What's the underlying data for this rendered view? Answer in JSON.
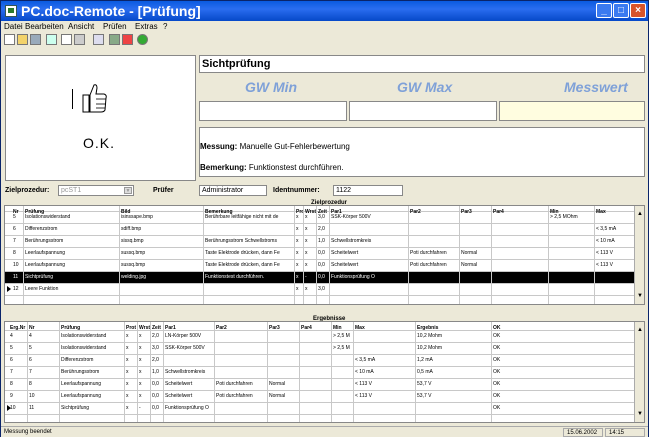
{
  "window": {
    "title": "PC.doc-Remote - [Prüfung]"
  },
  "menu": [
    "Datei",
    "Bearbeiten",
    "Ansicht",
    "Prüfen",
    "Extras",
    "?"
  ],
  "result": {
    "ok_label": "O.K.",
    "test_name": "Sichtprüfung"
  },
  "columns": {
    "gw_min": "GW Min",
    "gw_max": "GW Max",
    "messwert": "Messwert"
  },
  "messung": {
    "label": "Messung:",
    "value": "Manuelle Gut-Fehlerbewertung"
  },
  "bemerkung": {
    "label": "Bemerkung:",
    "value": "Funktionstest durchführen."
  },
  "form": {
    "zielprozedur_label": "Zielprozedur:",
    "zielprozedur_value": "pcST1",
    "pruefer_label": "Prüfer",
    "pruefer_value": "Administrator",
    "ident_label": "Identnummer:",
    "ident_value": "1122"
  },
  "upper_grid": {
    "caption": "Zielprozedur",
    "headers": [
      "Nr",
      "Prüfung",
      "Bild",
      "Bemerkung",
      "Prot",
      "WrstC",
      "Zeit",
      "Par1",
      "Par2",
      "Par3",
      "Par4",
      "Min",
      "Max"
    ],
    "rows": [
      [
        "5",
        "Isolationswiderstand",
        "isinssape.bmp",
        "Berührbare leitfähige nicht mit de",
        "x",
        "x",
        "3,0",
        "SSK-Körper 500V",
        "",
        "",
        "",
        "> 2,5 MOhm",
        ""
      ],
      [
        "6",
        "Differenzstrom",
        "sdiff.bmp",
        "",
        "x",
        "x",
        "2,0",
        "",
        "",
        "",
        "",
        "",
        "< 3,5 mA"
      ],
      [
        "7",
        "Berührungsstrom",
        "sissq.bmp",
        "Berührungsstrom Schwellstroms",
        "x",
        "x",
        "1,0",
        "Schwellstromkreis",
        "",
        "",
        "",
        "",
        "< 10 mA"
      ],
      [
        "8",
        "Leerlaufspannung",
        "sussq.bmp",
        "Taste Elektrode drücken, dann Fe",
        "x",
        "x",
        "0,0",
        "Scheitelwert",
        "Poti durchfahren",
        "Normal",
        "",
        "",
        "< 113 V"
      ],
      [
        "10",
        "Leerlaufspannung",
        "sussq.bmp",
        "Taste Elektrode drücken, dann Fe",
        "x",
        "x",
        "0,0",
        "Scheitelwert",
        "Poti durchfahren",
        "Normal",
        "",
        "",
        "< 113 V"
      ],
      [
        "11",
        "Sichtprüfung",
        "welding.jpg",
        "Funktionstest durchführen.",
        "x",
        "-",
        "0,0",
        "Funktionsprüfung O",
        "",
        "",
        "",
        "",
        ""
      ],
      [
        "12",
        "Leere Funktion",
        "",
        "",
        "x",
        "x",
        "3,0",
        "",
        "",
        "",
        "",
        "",
        ""
      ]
    ]
  },
  "lower_grid": {
    "caption": "Ergebnisse",
    "headers": [
      "Erg.Nr",
      "Nr",
      "Prüfung",
      "Prot",
      "WrstC",
      "Zeit",
      "Par1",
      "Par2",
      "Par3",
      "Par4",
      "Min",
      "Max",
      "Ergebnis",
      "OK"
    ],
    "rows": [
      [
        "4",
        "4",
        "Isolationswiderstand",
        "x",
        "x",
        "2,0",
        "LN-Körper 500V",
        "",
        "",
        "",
        "> 2,5 M",
        "",
        "10,2 Mohm",
        "OK"
      ],
      [
        "5",
        "5",
        "Isolationswiderstand",
        "x",
        "x",
        "3,0",
        "SSK-Körper 500V",
        "",
        "",
        "",
        "> 2,5 M",
        "",
        "10,2 Mohm",
        "OK"
      ],
      [
        "6",
        "6",
        "Differenzstrom",
        "x",
        "x",
        "2,0",
        "",
        "",
        "",
        "",
        "",
        "< 3,5 mA",
        "1,2 mA",
        "OK"
      ],
      [
        "7",
        "7",
        "Berührungsstrom",
        "x",
        "x",
        "1,0",
        "Schwellstromkreis",
        "",
        "",
        "",
        "",
        "< 10 mA",
        "0,5 mA",
        "OK"
      ],
      [
        "8",
        "8",
        "Leerlaufspannung",
        "x",
        "x",
        "0,0",
        "Scheitelwert",
        "Poti durchfahren",
        "Normal",
        "",
        "",
        "< 113 V",
        "53,7 V",
        "OK"
      ],
      [
        "9",
        "10",
        "Leerlaufspannung",
        "x",
        "x",
        "0,0",
        "Scheitelwert",
        "Poti durchfahren",
        "Normal",
        "",
        "",
        "< 113 V",
        "53,7 V",
        "OK"
      ],
      [
        "10",
        "11",
        "Sichtprüfung",
        "x",
        "-",
        "0,0",
        "Funktionsprüfung O",
        "",
        "",
        "",
        "",
        "",
        "",
        "OK"
      ]
    ]
  },
  "status": {
    "message": "Messung beendet",
    "date": "15.06.2002",
    "time": "14:15"
  }
}
